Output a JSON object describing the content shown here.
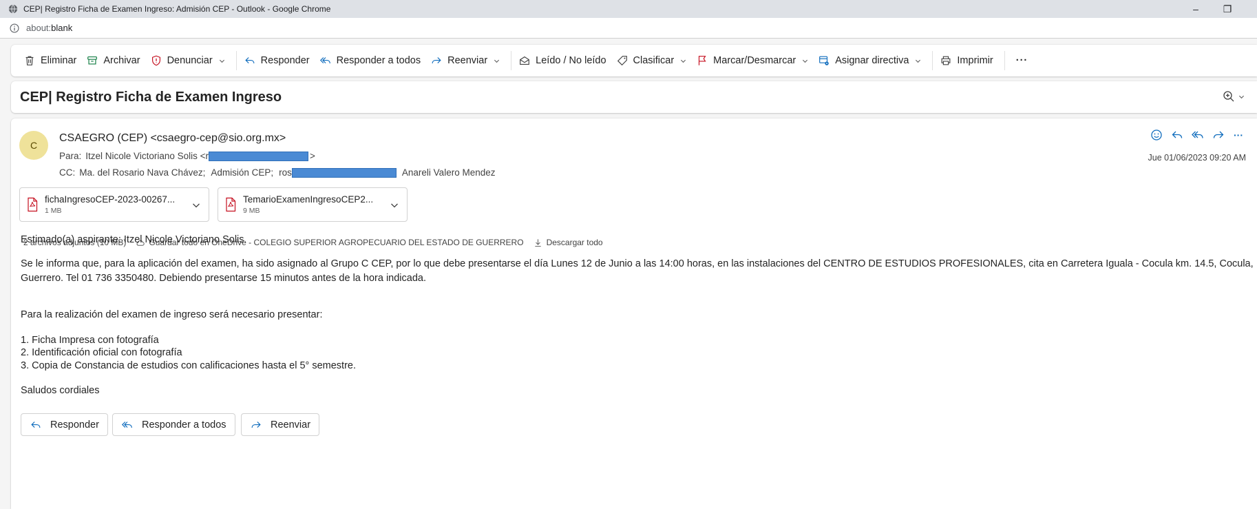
{
  "browser": {
    "window_title": "CEP| Registro Ficha de Examen Ingreso: Admisión CEP - Outlook - Google Chrome",
    "minimize_glyph": "–",
    "restore_glyph": "❐",
    "url_prefix": "about:",
    "url_path": "blank"
  },
  "toolbar": {
    "delete_label": "Eliminar",
    "archive_label": "Archivar",
    "report_label": "Denunciar",
    "reply_label": "Responder",
    "reply_all_label": "Responder a todos",
    "forward_label": "Reenviar",
    "read_unread_label": "Leído / No leído",
    "categorize_label": "Clasificar",
    "flag_label": "Marcar/Desmarcar",
    "policy_label": "Asignar directiva",
    "print_label": "Imprimir",
    "more_label": "···"
  },
  "message": {
    "subject": "CEP| Registro Ficha de Examen Ingreso",
    "avatar_initial": "C",
    "sender": "CSAEGRO (CEP) <csaegro-cep@sio.org.mx>",
    "to_label": "Para:",
    "to_name": "Itzel Nicole Victoriano Solis <r",
    "to_close": ">",
    "cc_label": "CC:",
    "cc_1": "Ma. del Rosario Nava Chávez;",
    "cc_2": "Admisión CEP;",
    "cc_3": "ros",
    "cc_4": "Anareli Valero Mendez",
    "date": "Jue 01/06/2023 09:20 AM",
    "more_actions": "···"
  },
  "attachments": {
    "items": [
      {
        "name": "fichaIngresoCEP-2023-00267...",
        "size": "1 MB"
      },
      {
        "name": "TemarioExamenIngresoCEP2...",
        "size": "9 MB"
      }
    ],
    "summary": "2 archivos adjuntos (10 MB)",
    "save_onedrive": "Guardar todo en OneDrive - COLEGIO SUPERIOR AGROPECUARIO DEL ESTADO DE GUERRERO",
    "download_all": "Descargar todo"
  },
  "body": {
    "greeting": "Estimado(a) aspirante: Itzel Nicole Victoriano Solis",
    "paragraph": "Se le informa que, para la aplicación del examen, ha sido asignado al Grupo C CEP, por lo que debe presentarse el día Lunes 12 de Junio a las 14:00 horas, en las instalaciones del CENTRO DE ESTUDIOS PROFESIONALES, cita en Carretera Iguala - Cocula km. 14.5, Cocula, Guerrero. Tel 01 736 3350480. Debiendo presentarse 15 minutos antes de la hora indicada.",
    "requirements_intro": "Para la realización del examen de ingreso será necesario presentar:",
    "requirements": [
      "1. Ficha Impresa con fotografía",
      "2. Identificación oficial con fotografía",
      "3. Copia de Constancia de estudios con calificaciones hasta el 5° semestre."
    ],
    "closing": "Saludos cordiales"
  },
  "reply_buttons": {
    "reply": "Responder",
    "reply_all": "Responder a todos",
    "forward": "Reenviar"
  },
  "colors": {
    "avatar_bg": "#efe29a",
    "accent": "#0f6cbd",
    "report_icon": "#c50f1f",
    "redaction": "#4a8ad4"
  }
}
